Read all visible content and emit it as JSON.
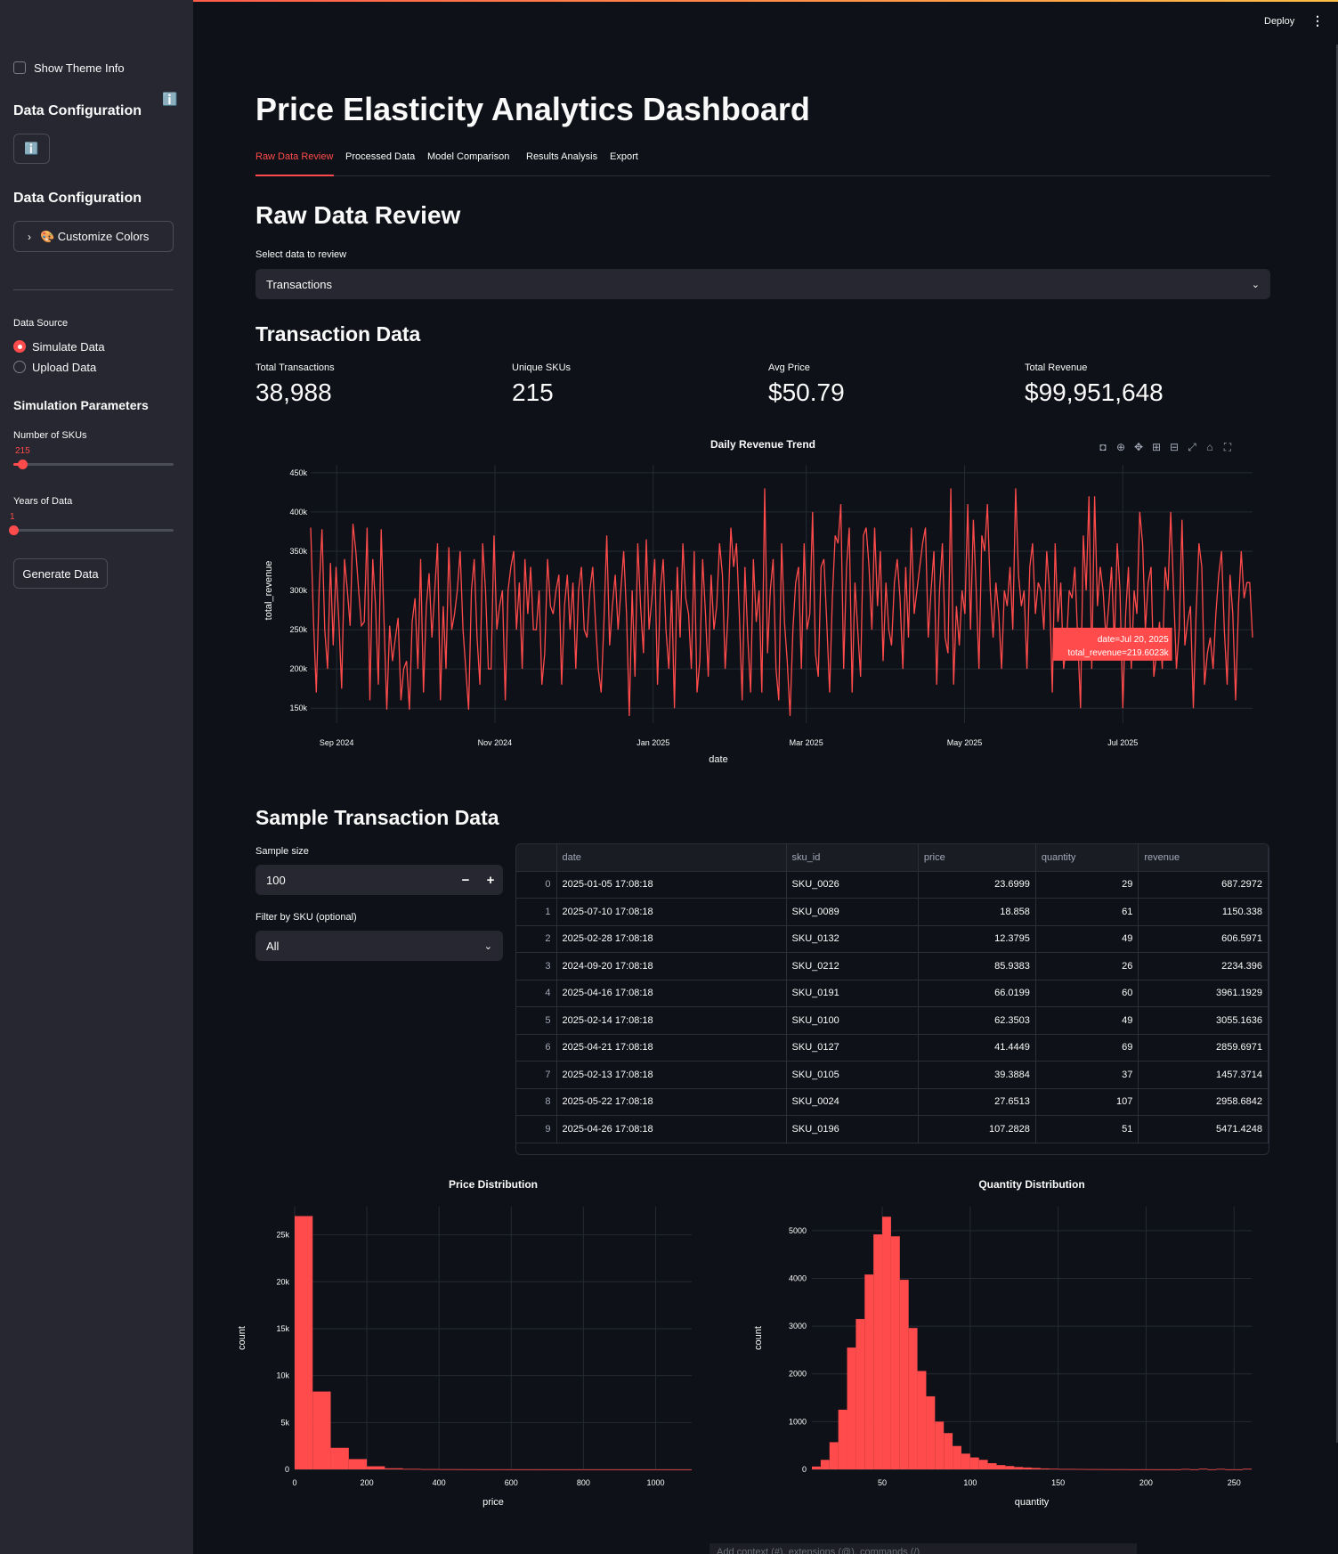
{
  "header": {
    "deploy_label": "Deploy",
    "menu_icon": "more-vertical-icon"
  },
  "sidebar": {
    "show_theme_label": "Show Theme Info",
    "data_config_1": "Data Configuration",
    "info_icon": "ℹ️",
    "info_button_icon": "ℹ️",
    "data_config_2": "Data Configuration",
    "customize_label": "🎨 Customize Colors",
    "data_source_label": "Data Source",
    "radio_simulate": "Simulate Data",
    "radio_upload": "Upload Data",
    "sim_params": "Simulation Parameters",
    "num_skus_label": "Number of SKUs",
    "num_skus_value": "215",
    "num_skus_fraction": 0.055,
    "years_label": "Years of Data",
    "years_value": "1",
    "years_fraction": 0,
    "generate_label": "Generate Data"
  },
  "main": {
    "title": "Price Elasticity Analytics Dashboard",
    "tabs": [
      "Raw Data Review",
      "Processed Data",
      "Model Comparison",
      "Results Analysis",
      "Export"
    ],
    "active_tab": 0,
    "section_title": "Raw Data Review",
    "select_label": "Select data to review",
    "select_value": "Transactions",
    "transaction_title": "Transaction Data",
    "metrics": [
      {
        "label": "Total Transactions",
        "value": "38,988"
      },
      {
        "label": "Unique SKUs",
        "value": "215"
      },
      {
        "label": "Avg Price",
        "value": "$50.79"
      },
      {
        "label": "Total Revenue",
        "value": "$99,951,648"
      }
    ],
    "sample_title": "Sample Transaction Data",
    "sample_size_label": "Sample size",
    "sample_size_value": "100",
    "filter_label": "Filter by SKU (optional)",
    "filter_value": "All",
    "table": {
      "columns": [
        "",
        "date",
        "sku_id",
        "price",
        "quantity",
        "revenue"
      ],
      "rows": [
        [
          "0",
          "2025-01-05 17:08:18",
          "SKU_0026",
          "23.6999",
          "29",
          "687.2972"
        ],
        [
          "1",
          "2025-07-10 17:08:18",
          "SKU_0089",
          "18.858",
          "61",
          "1150.338"
        ],
        [
          "2",
          "2025-02-28 17:08:18",
          "SKU_0132",
          "12.3795",
          "49",
          "606.5971"
        ],
        [
          "3",
          "2024-09-20 17:08:18",
          "SKU_0212",
          "85.9383",
          "26",
          "2234.396"
        ],
        [
          "4",
          "2025-04-16 17:08:18",
          "SKU_0191",
          "66.0199",
          "60",
          "3961.1929"
        ],
        [
          "5",
          "2025-02-14 17:08:18",
          "SKU_0100",
          "62.3503",
          "49",
          "3055.1636"
        ],
        [
          "6",
          "2025-04-21 17:08:18",
          "SKU_0127",
          "41.4449",
          "69",
          "2859.6971"
        ],
        [
          "7",
          "2025-02-13 17:08:18",
          "SKU_0105",
          "39.3884",
          "37",
          "1457.3714"
        ],
        [
          "8",
          "2025-05-22 17:08:18",
          "SKU_0024",
          "27.6513",
          "107",
          "2958.6842"
        ],
        [
          "9",
          "2025-04-26 17:08:18",
          "SKU_0196",
          "107.2828",
          "51",
          "5471.4248"
        ]
      ]
    },
    "chat_placeholder": "Add context (#), extensions (@), commands (/)"
  },
  "colors": {
    "accent": "#ff4b4b",
    "bg": "#0e1117",
    "sidebar": "#262730"
  },
  "chart_data": [
    {
      "type": "line",
      "title": "Daily Revenue Trend",
      "xlabel": "date",
      "ylabel": "total_revenue",
      "x_ticks": [
        "Sep 2024",
        "Nov 2024",
        "Jan 2025",
        "Mar 2025",
        "May 2025",
        "Jul 2025"
      ],
      "y_ticks": [
        "150k",
        "200k",
        "250k",
        "300k",
        "350k",
        "400k",
        "450k"
      ],
      "ylim": [
        140000,
        460000
      ],
      "x_range": [
        "2024-08-22",
        "2025-08-20"
      ],
      "tooltip": [
        "date=Jul 20, 2025",
        "total_revenue=219.6023k"
      ],
      "series": [
        {
          "values_note_hidden": true,
          "values": [
            380000,
            260000,
            170000,
            300000,
            378000,
            250000,
            200000,
            335000,
            230000,
            330000,
            260000,
            175000,
            340000,
            300000,
            255000,
            385000,
            350000,
            300000,
            255000,
            260000,
            380000,
            160000,
            340000,
            280000,
            180000,
            378000,
            260000,
            148000,
            255000,
            210000,
            238000,
            265000,
            160000,
            200000,
            210000,
            148000,
            260000,
            290000,
            200000,
            340000,
            170000,
            280000,
            322000,
            240000,
            300000,
            360000,
            160000,
            280000,
            200000,
            355000,
            250000,
            270000,
            300000,
            350000,
            250000,
            200000,
            148000,
            300000,
            340000,
            240000,
            180000,
            360000,
            300000,
            200000,
            200000,
            370000,
            250000,
            280000,
            300000,
            160000,
            300000,
            330000,
            350000,
            250000,
            310000,
            200000,
            340000,
            270000,
            330000,
            250000,
            250000,
            300000,
            180000,
            220000,
            340000,
            280000,
            270000,
            300000,
            320000,
            180000,
            280000,
            320000,
            250000,
            310000,
            200000,
            300000,
            330000,
            250000,
            240000,
            300000,
            330000,
            260000,
            200000,
            170000,
            260000,
            370000,
            230000,
            280000,
            320000,
            250000,
            300000,
            350000,
            270000,
            140000,
            300000,
            190000,
            360000,
            280000,
            220000,
            365000,
            250000,
            290000,
            340000,
            180000,
            300000,
            340000,
            250000,
            200000,
            300000,
            150000,
            330000,
            240000,
            360000,
            290000,
            270000,
            200000,
            350000,
            170000,
            210000,
            340000,
            270000,
            190000,
            320000,
            250000,
            280000,
            360000,
            320000,
            200000,
            270000,
            380000,
            330000,
            360000,
            270000,
            160000,
            330000,
            240000,
            170000,
            340000,
            260000,
            300000,
            170000,
            430000,
            220000,
            300000,
            340000,
            200000,
            160000,
            360000,
            260000,
            210000,
            140000,
            250000,
            310000,
            330000,
            200000,
            360000,
            250000,
            270000,
            400000,
            220000,
            190000,
            330000,
            340000,
            260000,
            170000,
            290000,
            370000,
            360000,
            410000,
            200000,
            330000,
            380000,
            170000,
            310000,
            250000,
            190000,
            370000,
            380000,
            330000,
            250000,
            380000,
            280000,
            350000,
            210000,
            310000,
            250000,
            230000,
            310000,
            340000,
            290000,
            200000,
            330000,
            240000,
            380000,
            270000,
            300000,
            330000,
            360000,
            380000,
            240000,
            300000,
            350000,
            180000,
            300000,
            360000,
            240000,
            220000,
            430000,
            180000,
            280000,
            230000,
            300000,
            270000,
            410000,
            250000,
            390000,
            300000,
            200000,
            370000,
            350000,
            410000,
            300000,
            240000,
            310000,
            270000,
            200000,
            300000,
            280000,
            330000,
            250000,
            430000,
            320000,
            280000,
            300000,
            200000,
            330000,
            360000,
            270000,
            310000,
            300000,
            250000,
            350000,
            300000,
            170000,
            360000,
            260000,
            310000,
            200000,
            230000,
            300000,
            290000,
            330000,
            240000,
            150000,
            370000,
            300000,
            420000,
            200000,
            420000,
            280000,
            330000,
            300000,
            240000,
            280000,
            330000,
            230000,
            360000,
            300000,
            150000,
            270000,
            330000,
            200000,
            300000,
            270000,
            400000,
            360000,
            250000,
            310000,
            330000,
            190000,
            220000,
            260000,
            200000,
            330000,
            300000,
            400000,
            300000,
            200000,
            250000,
            390000,
            230000,
            260000,
            280000,
            150000,
            270000,
            360000,
            330000,
            180000,
            220000,
            240000,
            200000,
            270000,
            320000,
            350000,
            250000,
            180000,
            320000,
            270000,
            160000,
            280000,
            350000,
            290000,
            310000,
            310000,
            240000
          ]
        }
      ]
    },
    {
      "type": "bar",
      "title": "Price Distribution",
      "xlabel": "price",
      "ylabel": "count",
      "bin_width": 50,
      "bin_start": 0,
      "values": [
        27000,
        8300,
        2300,
        1100,
        330,
        120,
        60,
        30,
        20,
        15,
        10,
        8,
        6,
        5,
        4,
        4,
        3,
        3,
        2,
        2,
        2,
        1
      ],
      "x_ticks": [
        "0",
        "200",
        "400",
        "600",
        "800",
        "1000"
      ],
      "y_ticks": [
        "0",
        "5k",
        "10k",
        "15k",
        "20k",
        "25k"
      ],
      "xlim": [
        0,
        1100
      ],
      "ylim": [
        0,
        28000
      ]
    },
    {
      "type": "bar",
      "title": "Quantity Distribution",
      "xlabel": "quantity",
      "ylabel": "count",
      "bin_width": 5,
      "bin_start": 10,
      "values": [
        60,
        200,
        570,
        1250,
        2550,
        3150,
        4080,
        4920,
        5290,
        4880,
        3970,
        2960,
        2060,
        1530,
        1000,
        760,
        490,
        330,
        250,
        200,
        130,
        90,
        70,
        50,
        40,
        30,
        20,
        15,
        10,
        10,
        8,
        6,
        5,
        4,
        3,
        3,
        2,
        2,
        2,
        1,
        1,
        1,
        10,
        1,
        15,
        1,
        12,
        1,
        1,
        14
      ],
      "x_ticks": [
        "50",
        "100",
        "150",
        "200",
        "250"
      ],
      "y_ticks": [
        "0",
        "1000",
        "2000",
        "3000",
        "4000",
        "5000"
      ],
      "xlim": [
        10,
        260
      ],
      "ylim": [
        0,
        5500
      ]
    }
  ]
}
